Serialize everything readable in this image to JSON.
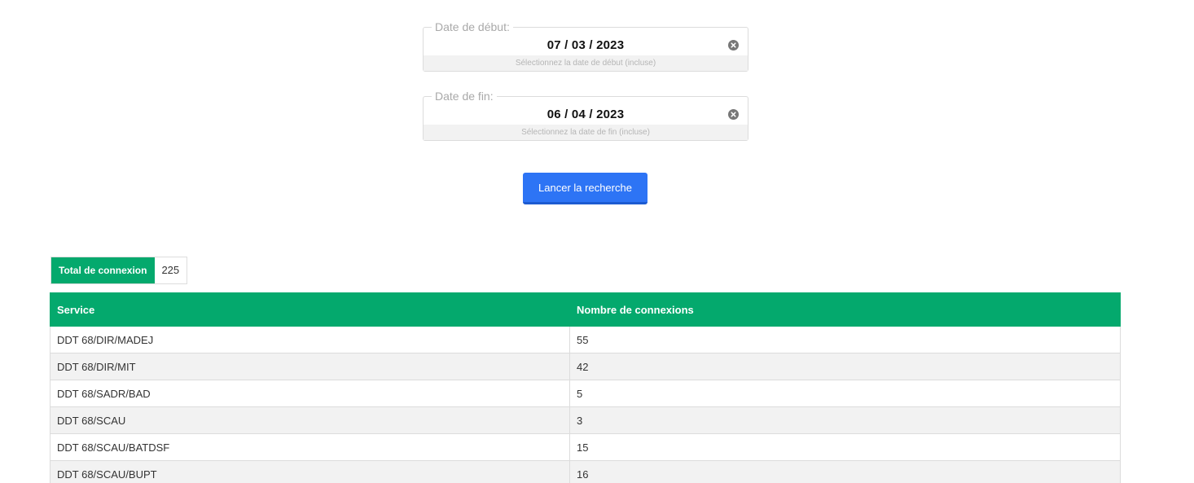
{
  "filters": {
    "start": {
      "legend": "Date de début:",
      "value": "07 / 03 / 2023",
      "hint": "Sélectionnez la date de début (incluse)"
    },
    "end": {
      "legend": "Date de fin:",
      "value": "06 / 04 / 2023",
      "hint": "Sélectionnez la date de fin (incluse)"
    },
    "clear_icon": "close-circle-icon"
  },
  "search_button": {
    "label": "Lancer la recherche"
  },
  "total": {
    "label": "Total de connexion",
    "value": "225"
  },
  "table": {
    "headers": [
      "Service",
      "Nombre de connexions"
    ],
    "rows": [
      [
        "DDT 68/DIR/MADEJ",
        "55"
      ],
      [
        "DDT 68/DIR/MIT",
        "42"
      ],
      [
        "DDT 68/SADR/BAD",
        "5"
      ],
      [
        "DDT 68/SCAU",
        "3"
      ],
      [
        "DDT 68/SCAU/BATDSF",
        "15"
      ],
      [
        "DDT 68/SCAU/BUPT",
        "16"
      ]
    ]
  },
  "colors": {
    "accent_green": "#04a96d",
    "button_blue": "#2d74f5",
    "row_alt": "#f2f2f2"
  }
}
